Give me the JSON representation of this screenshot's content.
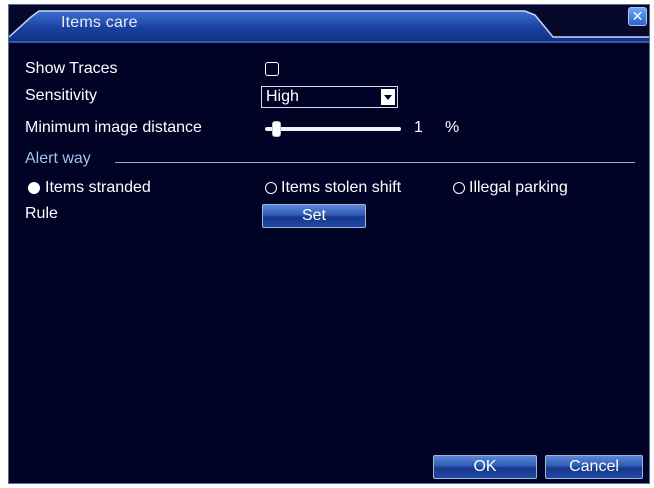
{
  "window": {
    "title": "Items care",
    "close_glyph": "✕",
    "close_icon": "close-icon"
  },
  "form": {
    "show_traces": {
      "label": "Show Traces",
      "checked": false
    },
    "sensitivity": {
      "label": "Sensitivity",
      "value": "High"
    },
    "minimum_image_distance": {
      "label": "Minimum image distance",
      "value": "1",
      "unit": "%",
      "level_percent": 1
    },
    "alert_way": {
      "label": "Alert way",
      "options": [
        {
          "label": "Items stranded",
          "selected": true
        },
        {
          "label": "Items stolen shift",
          "selected": false
        },
        {
          "label": "Illegal parking",
          "selected": false
        }
      ]
    },
    "rule": {
      "label": "Rule",
      "button_label": "Set"
    }
  },
  "footer": {
    "ok_label": "OK",
    "cancel_label": "Cancel"
  },
  "colors": {
    "background": "#000326",
    "title_gradient_top": "#3c6fd4",
    "title_gradient_bottom": "#0f2f86",
    "section_label": "#9ec0ee"
  }
}
